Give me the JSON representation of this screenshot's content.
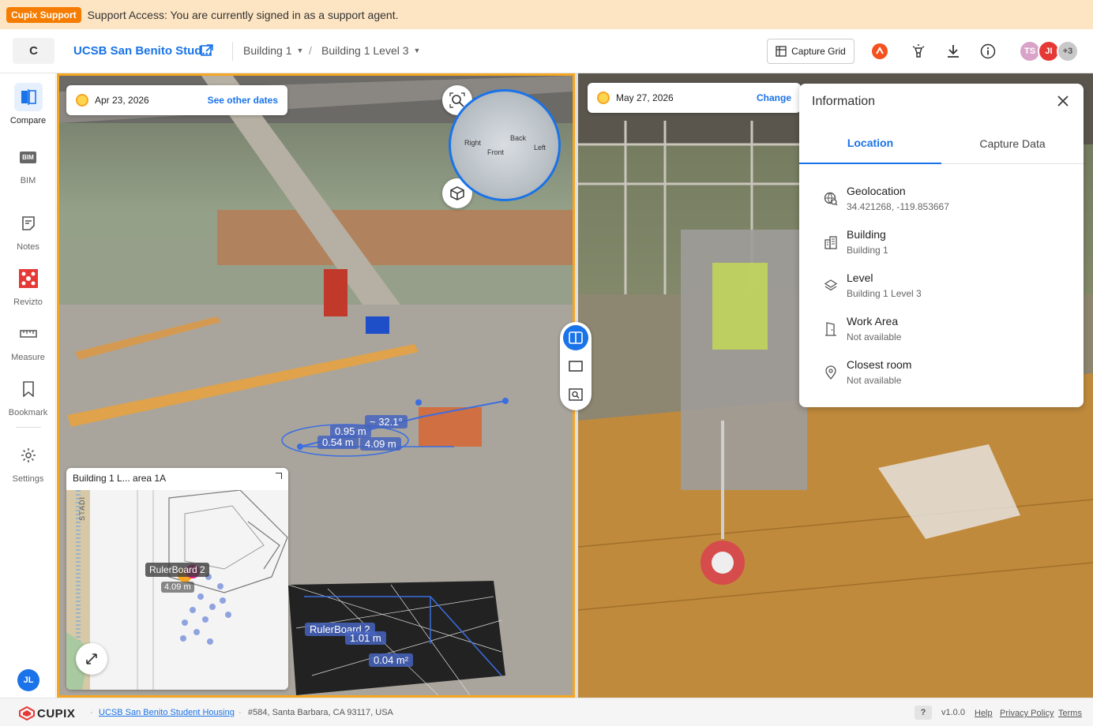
{
  "banner": {
    "badge": "Cupix Support",
    "message": "Support Access: You are currently signed in as a support agent."
  },
  "topbar": {
    "logo_letter": "C",
    "project_name": "UCSB San Benito Stud...",
    "breadcrumb_building": "Building 1",
    "breadcrumb_level": "Building 1 Level 3",
    "capture_grid_label": "Capture Grid",
    "avatars": [
      {
        "initials": "TS",
        "color": "#d9a3c9"
      },
      {
        "initials": "JI",
        "color": "#e53935"
      },
      {
        "initials": "+3",
        "color": "#c8c8c8"
      }
    ]
  },
  "rail": {
    "items": [
      {
        "label": "Compare"
      },
      {
        "label": "BIM"
      },
      {
        "label": "Notes"
      },
      {
        "label": "Revizto"
      },
      {
        "label": "Measure"
      },
      {
        "label": "Bookmark"
      },
      {
        "label": "Settings"
      }
    ],
    "bim_badge": "BIM",
    "user_initials": "JL"
  },
  "left_viewer": {
    "date": "Apr 23, 2026",
    "other_dates_link": "See other dates",
    "minimap_labels": {
      "right": "Right",
      "front": "Front",
      "back": "Back",
      "left": "Left"
    },
    "measurements": [
      "~ 32.1°",
      "0.95 m",
      "0.54 m",
      "4.09 m"
    ],
    "floorplan_title": "Building 1 L... area 1A",
    "floorplan_label": "RulerBoard 2",
    "floorplan_sub": "4.09 m",
    "floorplan_axis_text": "STADI",
    "bottom_labels": [
      "RulerBoard 2",
      "1.01 m",
      "0.04 m²"
    ]
  },
  "right_viewer": {
    "date": "May 27, 2026",
    "change_link": "Change"
  },
  "info_panel": {
    "title": "Information",
    "tabs": [
      "Location",
      "Capture Data"
    ],
    "rows": [
      {
        "label": "Geolocation",
        "value": "34.421268, -119.853667",
        "icon": "globe-search-icon"
      },
      {
        "label": "Building",
        "value": "Building 1",
        "icon": "building-icon"
      },
      {
        "label": "Level",
        "value": "Building 1 Level 3",
        "icon": "layers-icon"
      },
      {
        "label": "Work Area",
        "value": "Not available",
        "icon": "door-icon"
      },
      {
        "label": "Closest room",
        "value": "Not available",
        "icon": "pin-icon"
      }
    ]
  },
  "footer": {
    "brand": "CUPIX",
    "project_link": "UCSB San Benito Student Housing",
    "address": "#584, Santa Barbara, CA 93117, USA",
    "help_q": "?",
    "version": "v1.0.0",
    "help": "Help",
    "privacy": "Privacy Policy",
    "terms": "Terms"
  }
}
